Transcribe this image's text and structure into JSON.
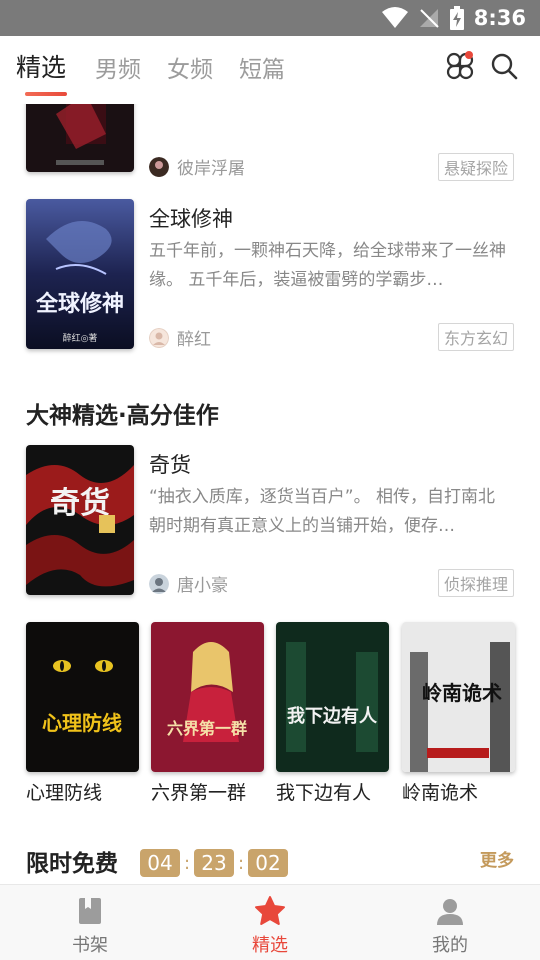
{
  "status_bar": {
    "time": "8:36"
  },
  "tabs": [
    {
      "label": "精选",
      "active": true
    },
    {
      "label": "男频",
      "active": false
    },
    {
      "label": "女频",
      "active": false
    },
    {
      "label": "短篇",
      "active": false
    }
  ],
  "top_icons": [
    "apps-icon",
    "search-icon"
  ],
  "books": [
    {
      "title": "",
      "author": "彼岸浮屠",
      "tag": "悬疑探险"
    },
    {
      "title": "全球修神",
      "desc": "五千年前，一颗神石天降，给全球带来了一丝神缘。 五千年后，装逼被雷劈的学霸步…",
      "author": "醉红",
      "tag": "东方玄幻",
      "cover_text": "全球修神",
      "cover_author": "醉红◎著"
    }
  ],
  "section": {
    "title": "大神精选·高分佳作"
  },
  "featured": {
    "title": "奇货",
    "desc": "“抽衣入质库，逐货当百户”。 相传，自打南北朝时期有真正意义上的当铺开始，便存…",
    "author": "唐小豪",
    "tag": "侦探推理",
    "cover_text": "奇货"
  },
  "grid": [
    {
      "title": "心理防线",
      "cover_text": "心理防线"
    },
    {
      "title": "六界第一群",
      "cover_text": "六界第一群"
    },
    {
      "title": "我下边有人",
      "cover_text": "我下边有人"
    },
    {
      "title": "岭南诡术",
      "cover_text": "岭南诡术"
    }
  ],
  "free_section": {
    "title": "限时免费",
    "countdown": {
      "h": "04",
      "m": "23",
      "s": "02"
    },
    "more": "更多"
  },
  "bottom_nav": [
    {
      "label": "书架",
      "icon": "bookshelf-icon",
      "active": false
    },
    {
      "label": "精选",
      "icon": "star-icon",
      "active": true
    },
    {
      "label": "我的",
      "icon": "profile-icon",
      "active": false
    }
  ],
  "colors": {
    "accent": "#e8483b",
    "gold": "#c9a46b",
    "status_bar": "#7a7a7a"
  }
}
